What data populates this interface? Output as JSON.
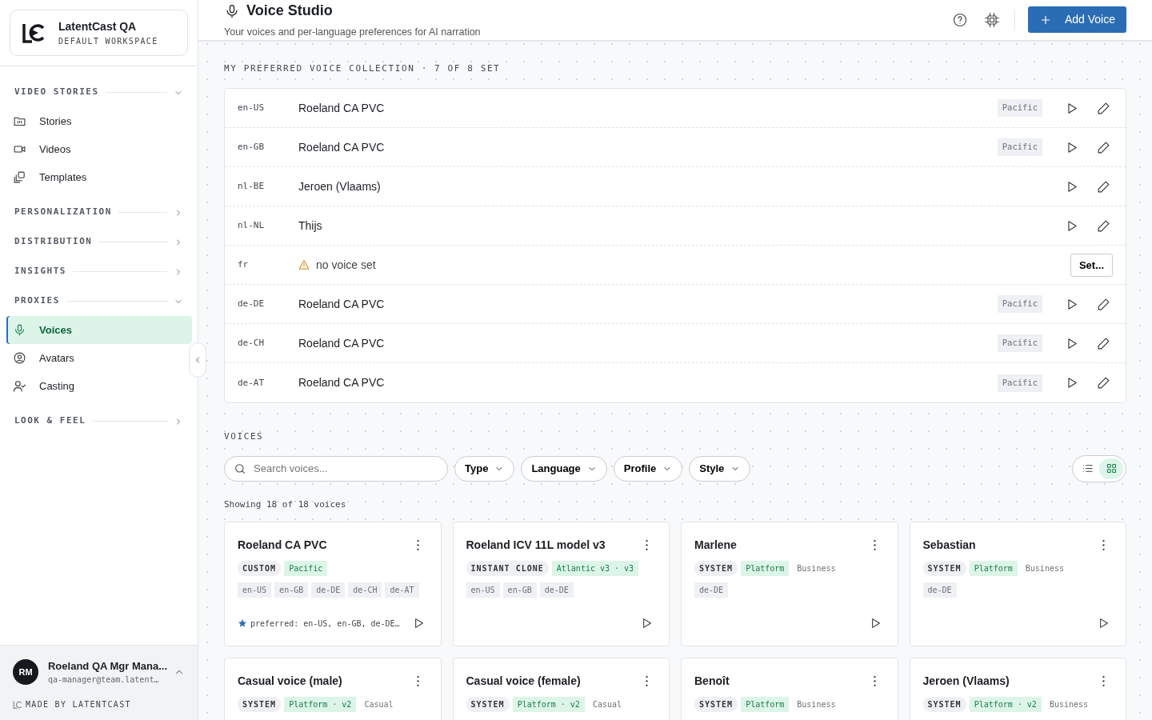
{
  "workspace": {
    "name": "LatentCast QA",
    "subtitle": "DEFAULT WORKSPACE"
  },
  "sidebar": {
    "sections": [
      {
        "label": "VIDEO STORIES",
        "expanded": true,
        "items": [
          {
            "label": "Stories",
            "selected": false
          },
          {
            "label": "Videos",
            "selected": false
          },
          {
            "label": "Templates",
            "selected": false
          }
        ]
      },
      {
        "label": "PERSONALIZATION",
        "expanded": false
      },
      {
        "label": "DISTRIBUTION",
        "expanded": false
      },
      {
        "label": "INSIGHTS",
        "expanded": false
      },
      {
        "label": "PROXIES",
        "expanded": true,
        "items": [
          {
            "label": "Voices",
            "selected": true
          },
          {
            "label": "Avatars",
            "selected": false
          },
          {
            "label": "Casting",
            "selected": false
          }
        ]
      },
      {
        "label": "LOOK & FEEL",
        "expanded": false
      }
    ],
    "user": {
      "initials": "RM",
      "name": "Roeland QA Mgr Mana...",
      "email": "qa-manager@team.latent…"
    },
    "footer": "MADE BY LATENTCAST"
  },
  "header": {
    "title": "Voice Studio",
    "subtitle": "Your voices and per-language preferences for AI narration",
    "button": "Add Voice"
  },
  "preferred": {
    "heading": "MY PREFERRED VOICE COLLECTION · 7 OF 8 SET",
    "rows": [
      {
        "lang": "en-US",
        "voice": "Roeland CA PVC",
        "tag": "Pacific"
      },
      {
        "lang": "en-GB",
        "voice": "Roeland CA PVC",
        "tag": "Pacific"
      },
      {
        "lang": "nl-BE",
        "voice": "Jeroen (Vlaams)"
      },
      {
        "lang": "nl-NL",
        "voice": "Thijs"
      },
      {
        "lang": "fr",
        "voice": "no voice set",
        "unset": true,
        "button": "Set..."
      },
      {
        "lang": "de-DE",
        "voice": "Roeland CA PVC",
        "tag": "Pacific"
      },
      {
        "lang": "de-CH",
        "voice": "Roeland CA PVC",
        "tag": "Pacific"
      },
      {
        "lang": "de-AT",
        "voice": "Roeland CA PVC",
        "tag": "Pacific"
      }
    ]
  },
  "voices": {
    "heading": "VOICES",
    "search": {
      "placeholder": "Search voices..."
    },
    "filters": [
      "Type",
      "Language",
      "Profile",
      "Style"
    ],
    "views": [
      {
        "kind": "list",
        "selected": false
      },
      {
        "kind": "grid",
        "selected": true
      }
    ],
    "count": "Showing 18 of 18 voices",
    "cards": [
      {
        "title": "Roeland CA PVC",
        "type": "CUSTOM",
        "profile": "Pacific",
        "langs": [
          "en-US",
          "en-GB",
          "de-DE",
          "de-CH",
          "de-AT"
        ],
        "preferred": "preferred: en-US, en-GB, de-DE…"
      },
      {
        "title": "Roeland ICV 11L model v3",
        "type": "INSTANT CLONE",
        "profile": "Atlantic v3 · v3",
        "langs": [
          "en-US",
          "en-GB",
          "de-DE"
        ]
      },
      {
        "title": "Marlene",
        "type": "SYSTEM",
        "profile": "Platform",
        "style": "Business",
        "langs": [
          "de-DE"
        ]
      },
      {
        "title": "Sebastian",
        "type": "SYSTEM",
        "profile": "Platform",
        "style": "Business",
        "langs": [
          "de-DE"
        ]
      },
      {
        "title": "Casual voice (male)",
        "type": "SYSTEM",
        "profile": "Platform · v2",
        "style": "Casual"
      },
      {
        "title": "Casual voice (female)",
        "type": "SYSTEM",
        "profile": "Platform · v2",
        "style": "Casual"
      },
      {
        "title": "Benoît",
        "type": "SYSTEM",
        "profile": "Platform",
        "style": "Business"
      },
      {
        "title": "Jeroen (Vlaams)",
        "type": "SYSTEM",
        "profile": "Platform · v2",
        "style": "Business"
      }
    ]
  }
}
